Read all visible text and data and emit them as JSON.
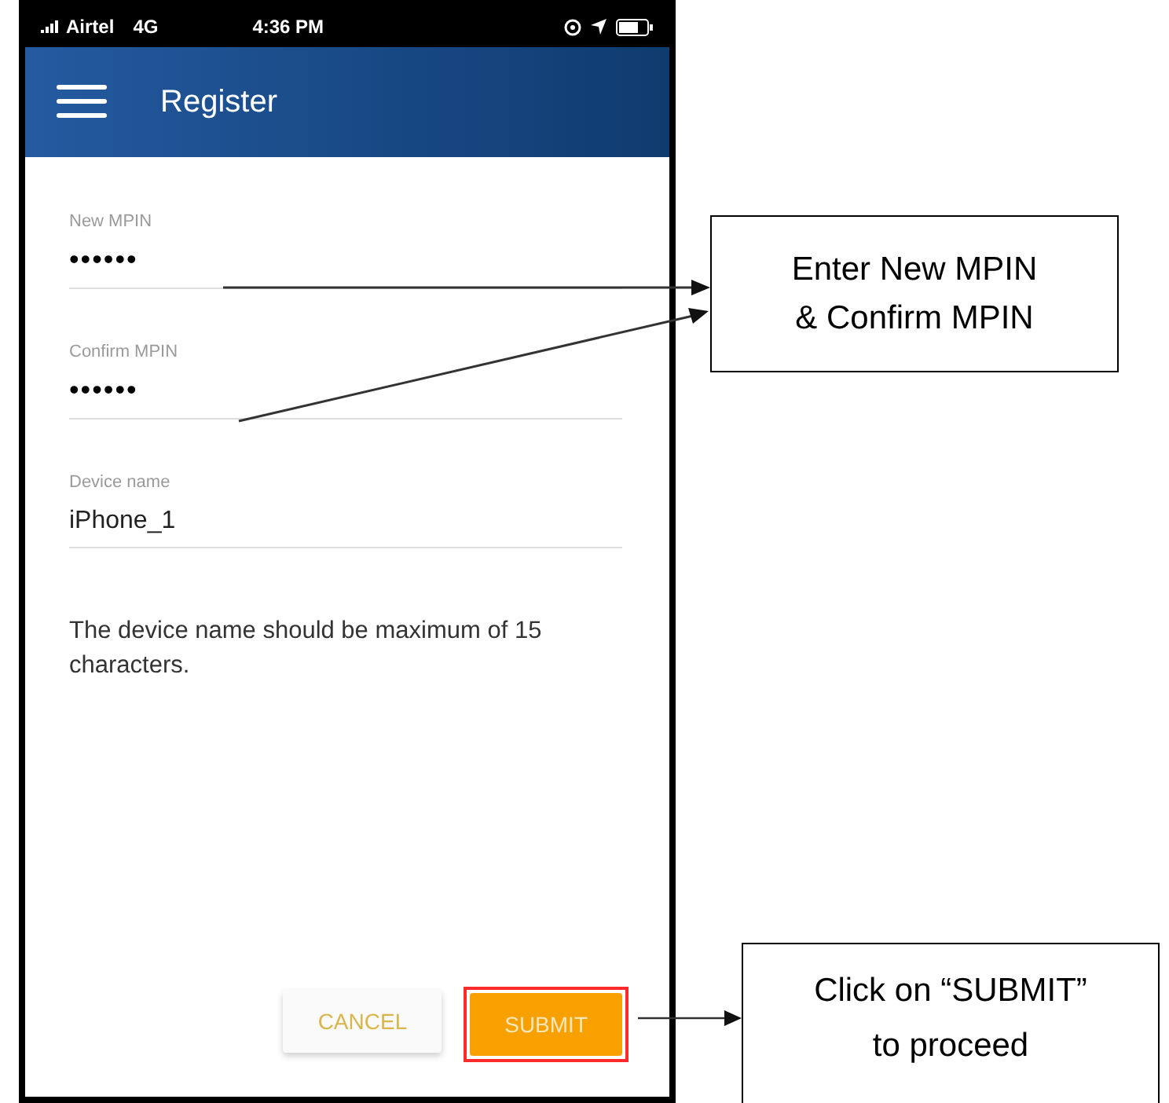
{
  "status_bar": {
    "carrier": "Airtel",
    "network": "4G",
    "time": "4:36 PM"
  },
  "header": {
    "title": "Register"
  },
  "fields": [
    {
      "label": "New MPIN",
      "value": "••••••",
      "kind": "password"
    },
    {
      "label": "Confirm MPIN",
      "value": "••••••",
      "kind": "password"
    },
    {
      "label": "Device name",
      "value": "iPhone_1",
      "kind": "text"
    }
  ],
  "note": "The device name should be maximum of 15 characters.",
  "buttons": [
    {
      "label": "CANCEL",
      "kind": "secondary",
      "highlighted": false
    },
    {
      "label": "SUBMIT",
      "kind": "primary",
      "highlighted": true
    }
  ],
  "callouts": [
    {
      "lines": [
        "Enter New MPIN",
        "& Confirm MPIN"
      ]
    },
    {
      "lines": [
        "Click on “SUBMIT”",
        "to proceed"
      ]
    }
  ]
}
